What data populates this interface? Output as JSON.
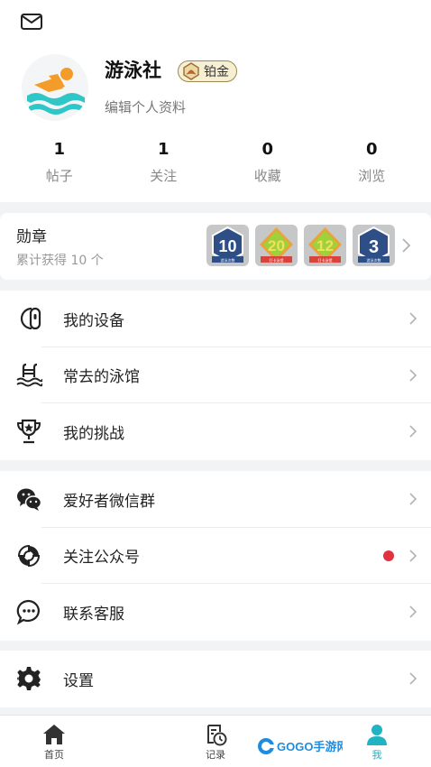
{
  "header": {
    "mail_icon": "mail-icon"
  },
  "profile": {
    "avatar_icon": "swimmer-icon",
    "nickname": "游泳社",
    "level": "铂金",
    "edit_link": "编辑个人资料"
  },
  "stats": [
    {
      "value": "1",
      "label": "帖子"
    },
    {
      "value": "1",
      "label": "关注"
    },
    {
      "value": "0",
      "label": "收藏"
    },
    {
      "value": "0",
      "label": "浏览"
    }
  ],
  "badges": {
    "title": "勋章",
    "subtitle": "累计获得 10 个",
    "items": [
      {
        "value": "10",
        "caption": "游泳次数",
        "color": "#2d4e86"
      },
      {
        "value": "20",
        "caption": "打卡泳馆",
        "color": "#9fd23a"
      },
      {
        "value": "12",
        "caption": "打卡泳馆",
        "color": "#9fd23a"
      },
      {
        "value": "3",
        "caption": "游泳次数",
        "color": "#2d4e86"
      }
    ]
  },
  "menu_group_1": [
    {
      "label": "我的设备",
      "icon": "device-icon"
    },
    {
      "label": "常去的泳馆",
      "icon": "pool-icon"
    },
    {
      "label": "我的挑战",
      "icon": "trophy-icon"
    }
  ],
  "menu_group_2": [
    {
      "label": "爱好者微信群",
      "icon": "wechat-icon"
    },
    {
      "label": "关注公众号",
      "icon": "official-account-icon",
      "has_dot": true
    },
    {
      "label": "联系客服",
      "icon": "customer-service-icon"
    }
  ],
  "menu_group_3": [
    {
      "label": "设置",
      "icon": "gear-icon"
    }
  ],
  "bottom_nav": {
    "items": [
      {
        "label": "首页",
        "icon": "home-icon"
      },
      {
        "label": "记录",
        "icon": "record-icon"
      },
      {
        "label": "我",
        "icon": "user-icon",
        "active": true
      }
    ],
    "watermark": "GOGO手游网"
  },
  "colors": {
    "accent": "#1fb3c4",
    "red_dot": "#e0333f",
    "avatar_orange": "#f39c2a",
    "avatar_water": "#2fc6c7"
  }
}
